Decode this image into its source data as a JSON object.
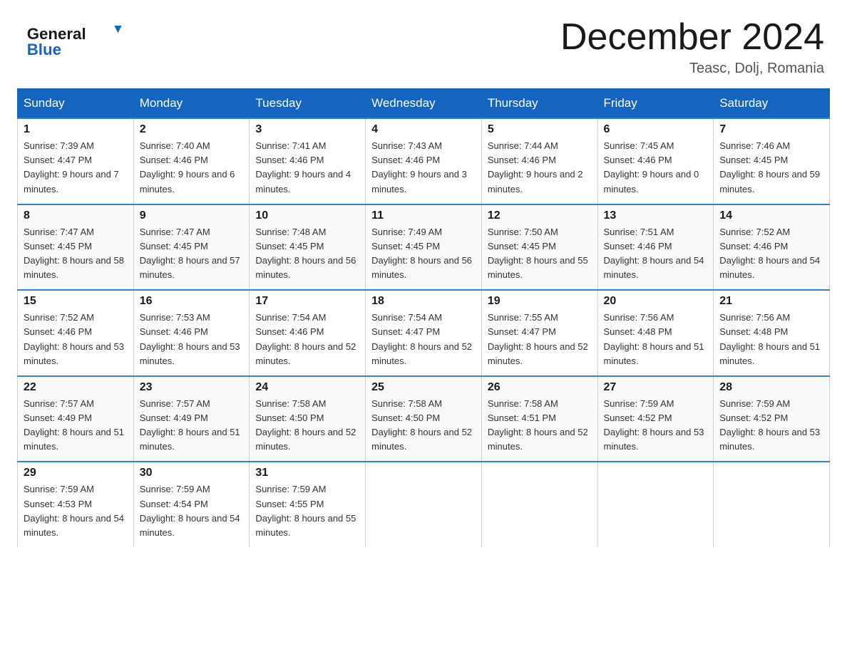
{
  "header": {
    "logo_general": "General",
    "logo_blue": "Blue",
    "title": "December 2024",
    "location": "Teasc, Dolj, Romania"
  },
  "days_of_week": [
    "Sunday",
    "Monday",
    "Tuesday",
    "Wednesday",
    "Thursday",
    "Friday",
    "Saturday"
  ],
  "weeks": [
    [
      {
        "day": "1",
        "sunrise": "7:39 AM",
        "sunset": "4:47 PM",
        "daylight": "9 hours and 7 minutes."
      },
      {
        "day": "2",
        "sunrise": "7:40 AM",
        "sunset": "4:46 PM",
        "daylight": "9 hours and 6 minutes."
      },
      {
        "day": "3",
        "sunrise": "7:41 AM",
        "sunset": "4:46 PM",
        "daylight": "9 hours and 4 minutes."
      },
      {
        "day": "4",
        "sunrise": "7:43 AM",
        "sunset": "4:46 PM",
        "daylight": "9 hours and 3 minutes."
      },
      {
        "day": "5",
        "sunrise": "7:44 AM",
        "sunset": "4:46 PM",
        "daylight": "9 hours and 2 minutes."
      },
      {
        "day": "6",
        "sunrise": "7:45 AM",
        "sunset": "4:46 PM",
        "daylight": "9 hours and 0 minutes."
      },
      {
        "day": "7",
        "sunrise": "7:46 AM",
        "sunset": "4:45 PM",
        "daylight": "8 hours and 59 minutes."
      }
    ],
    [
      {
        "day": "8",
        "sunrise": "7:47 AM",
        "sunset": "4:45 PM",
        "daylight": "8 hours and 58 minutes."
      },
      {
        "day": "9",
        "sunrise": "7:47 AM",
        "sunset": "4:45 PM",
        "daylight": "8 hours and 57 minutes."
      },
      {
        "day": "10",
        "sunrise": "7:48 AM",
        "sunset": "4:45 PM",
        "daylight": "8 hours and 56 minutes."
      },
      {
        "day": "11",
        "sunrise": "7:49 AM",
        "sunset": "4:45 PM",
        "daylight": "8 hours and 56 minutes."
      },
      {
        "day": "12",
        "sunrise": "7:50 AM",
        "sunset": "4:45 PM",
        "daylight": "8 hours and 55 minutes."
      },
      {
        "day": "13",
        "sunrise": "7:51 AM",
        "sunset": "4:46 PM",
        "daylight": "8 hours and 54 minutes."
      },
      {
        "day": "14",
        "sunrise": "7:52 AM",
        "sunset": "4:46 PM",
        "daylight": "8 hours and 54 minutes."
      }
    ],
    [
      {
        "day": "15",
        "sunrise": "7:52 AM",
        "sunset": "4:46 PM",
        "daylight": "8 hours and 53 minutes."
      },
      {
        "day": "16",
        "sunrise": "7:53 AM",
        "sunset": "4:46 PM",
        "daylight": "8 hours and 53 minutes."
      },
      {
        "day": "17",
        "sunrise": "7:54 AM",
        "sunset": "4:46 PM",
        "daylight": "8 hours and 52 minutes."
      },
      {
        "day": "18",
        "sunrise": "7:54 AM",
        "sunset": "4:47 PM",
        "daylight": "8 hours and 52 minutes."
      },
      {
        "day": "19",
        "sunrise": "7:55 AM",
        "sunset": "4:47 PM",
        "daylight": "8 hours and 52 minutes."
      },
      {
        "day": "20",
        "sunrise": "7:56 AM",
        "sunset": "4:48 PM",
        "daylight": "8 hours and 51 minutes."
      },
      {
        "day": "21",
        "sunrise": "7:56 AM",
        "sunset": "4:48 PM",
        "daylight": "8 hours and 51 minutes."
      }
    ],
    [
      {
        "day": "22",
        "sunrise": "7:57 AM",
        "sunset": "4:49 PM",
        "daylight": "8 hours and 51 minutes."
      },
      {
        "day": "23",
        "sunrise": "7:57 AM",
        "sunset": "4:49 PM",
        "daylight": "8 hours and 51 minutes."
      },
      {
        "day": "24",
        "sunrise": "7:58 AM",
        "sunset": "4:50 PM",
        "daylight": "8 hours and 52 minutes."
      },
      {
        "day": "25",
        "sunrise": "7:58 AM",
        "sunset": "4:50 PM",
        "daylight": "8 hours and 52 minutes."
      },
      {
        "day": "26",
        "sunrise": "7:58 AM",
        "sunset": "4:51 PM",
        "daylight": "8 hours and 52 minutes."
      },
      {
        "day": "27",
        "sunrise": "7:59 AM",
        "sunset": "4:52 PM",
        "daylight": "8 hours and 53 minutes."
      },
      {
        "day": "28",
        "sunrise": "7:59 AM",
        "sunset": "4:52 PM",
        "daylight": "8 hours and 53 minutes."
      }
    ],
    [
      {
        "day": "29",
        "sunrise": "7:59 AM",
        "sunset": "4:53 PM",
        "daylight": "8 hours and 54 minutes."
      },
      {
        "day": "30",
        "sunrise": "7:59 AM",
        "sunset": "4:54 PM",
        "daylight": "8 hours and 54 minutes."
      },
      {
        "day": "31",
        "sunrise": "7:59 AM",
        "sunset": "4:55 PM",
        "daylight": "8 hours and 55 minutes."
      },
      {
        "day": "",
        "sunrise": "",
        "sunset": "",
        "daylight": ""
      },
      {
        "day": "",
        "sunrise": "",
        "sunset": "",
        "daylight": ""
      },
      {
        "day": "",
        "sunrise": "",
        "sunset": "",
        "daylight": ""
      },
      {
        "day": "",
        "sunrise": "",
        "sunset": "",
        "daylight": ""
      }
    ]
  ],
  "labels": {
    "sunrise": "Sunrise:",
    "sunset": "Sunset:",
    "daylight": "Daylight:"
  }
}
